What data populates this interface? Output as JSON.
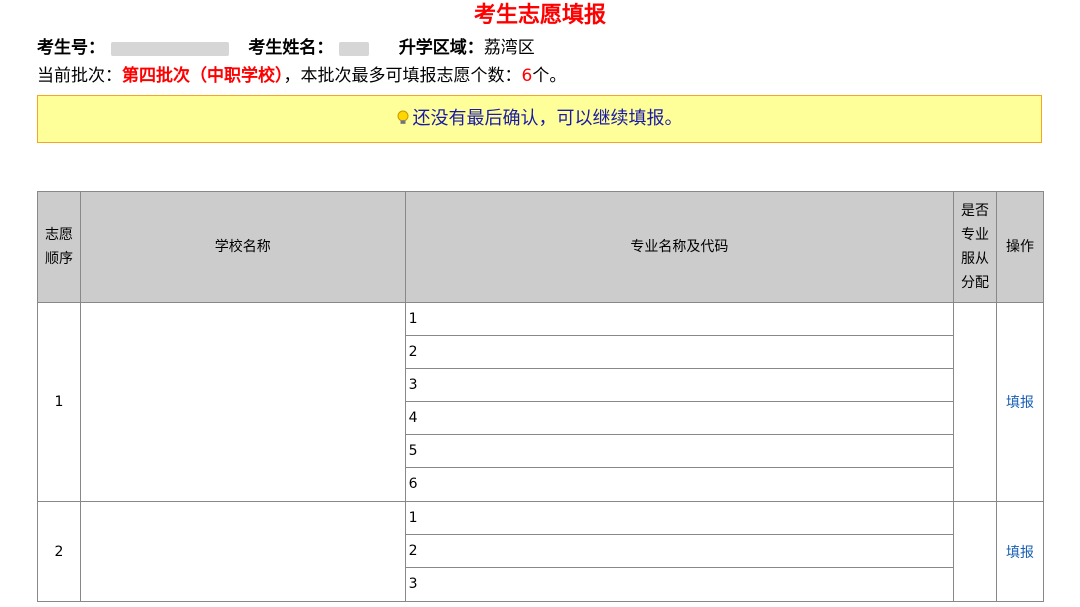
{
  "page": {
    "title": "考生志愿填报"
  },
  "student": {
    "id_label": "考生号：",
    "name_label": "考生姓名：",
    "region_label": "升学区域：",
    "region_value": "荔湾区"
  },
  "batch": {
    "label": "当前批次：",
    "value": "第四批次（中职学校）",
    "mid_text": "，本批次最多可填报志愿个数：",
    "max_count": "6",
    "unit": "个。"
  },
  "notice": {
    "icon": "lightbulb-icon",
    "text": "还没有最后确认，可以继续填报。"
  },
  "table": {
    "headers": {
      "order": "志愿顺序",
      "school": "学校名称",
      "major": "专业名称及代码",
      "assign": "是否专业服从分配",
      "operation": "操作"
    },
    "rows": [
      {
        "order": "1",
        "school": "",
        "majors": [
          "1",
          "2",
          "3",
          "4",
          "5",
          "6"
        ],
        "action": "填报"
      },
      {
        "order": "2",
        "school": "",
        "majors": [
          "1",
          "2",
          "3"
        ],
        "action": "填报"
      }
    ]
  },
  "colors": {
    "title": "#ff0000",
    "notice_bg": "#ffff99",
    "notice_border": "#f5a623",
    "notice_text": "#1a1aa6",
    "header_bg": "#cccccc",
    "link": "#1a5fb4"
  }
}
